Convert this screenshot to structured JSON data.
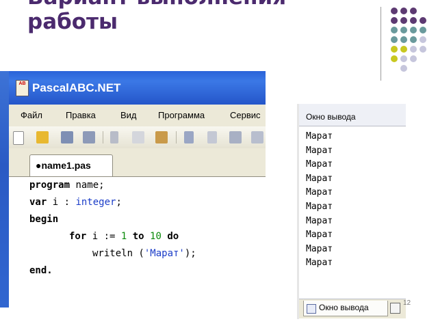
{
  "slide": {
    "title": "Вариант выполнения\nработы",
    "page_number": "12"
  },
  "dots": {
    "colors": {
      "purple": "#5d3a72",
      "teal": "#6a9a9c",
      "yellow": "#c8c820",
      "lavender": "#c6c6dc"
    }
  },
  "ide": {
    "logo_text": "AB",
    "title": "PascalABC.NET",
    "menu": [
      "Файл",
      "Правка",
      "Вид",
      "Программа",
      "Сервис"
    ],
    "tab_label": "●name1.pas",
    "code": {
      "line1": {
        "kw": "program",
        "rest": " name;"
      },
      "line2": {
        "kw": "var",
        "mid": " i : ",
        "type": "integer",
        "end": ";"
      },
      "line3": {
        "kw": "begin"
      },
      "line4": {
        "kw1": "for",
        "mid1": " i := ",
        "num1": "1",
        "sp": " ",
        "kw2": "to",
        "sp2": " ",
        "num2": "10",
        "sp3": " ",
        "kw3": "do"
      },
      "line5": {
        "pre": "writeln (",
        "str": "'Марат'",
        "post": ");"
      },
      "line6": {
        "kw": "end."
      }
    }
  },
  "output": {
    "title": "Окно вывода",
    "lines": [
      "Марат",
      "Марат",
      "Марат",
      "Марат",
      "Марат",
      "Марат",
      "Марат",
      "Марат",
      "Марат",
      "Марат"
    ],
    "tab_label": "Окно вывода"
  }
}
